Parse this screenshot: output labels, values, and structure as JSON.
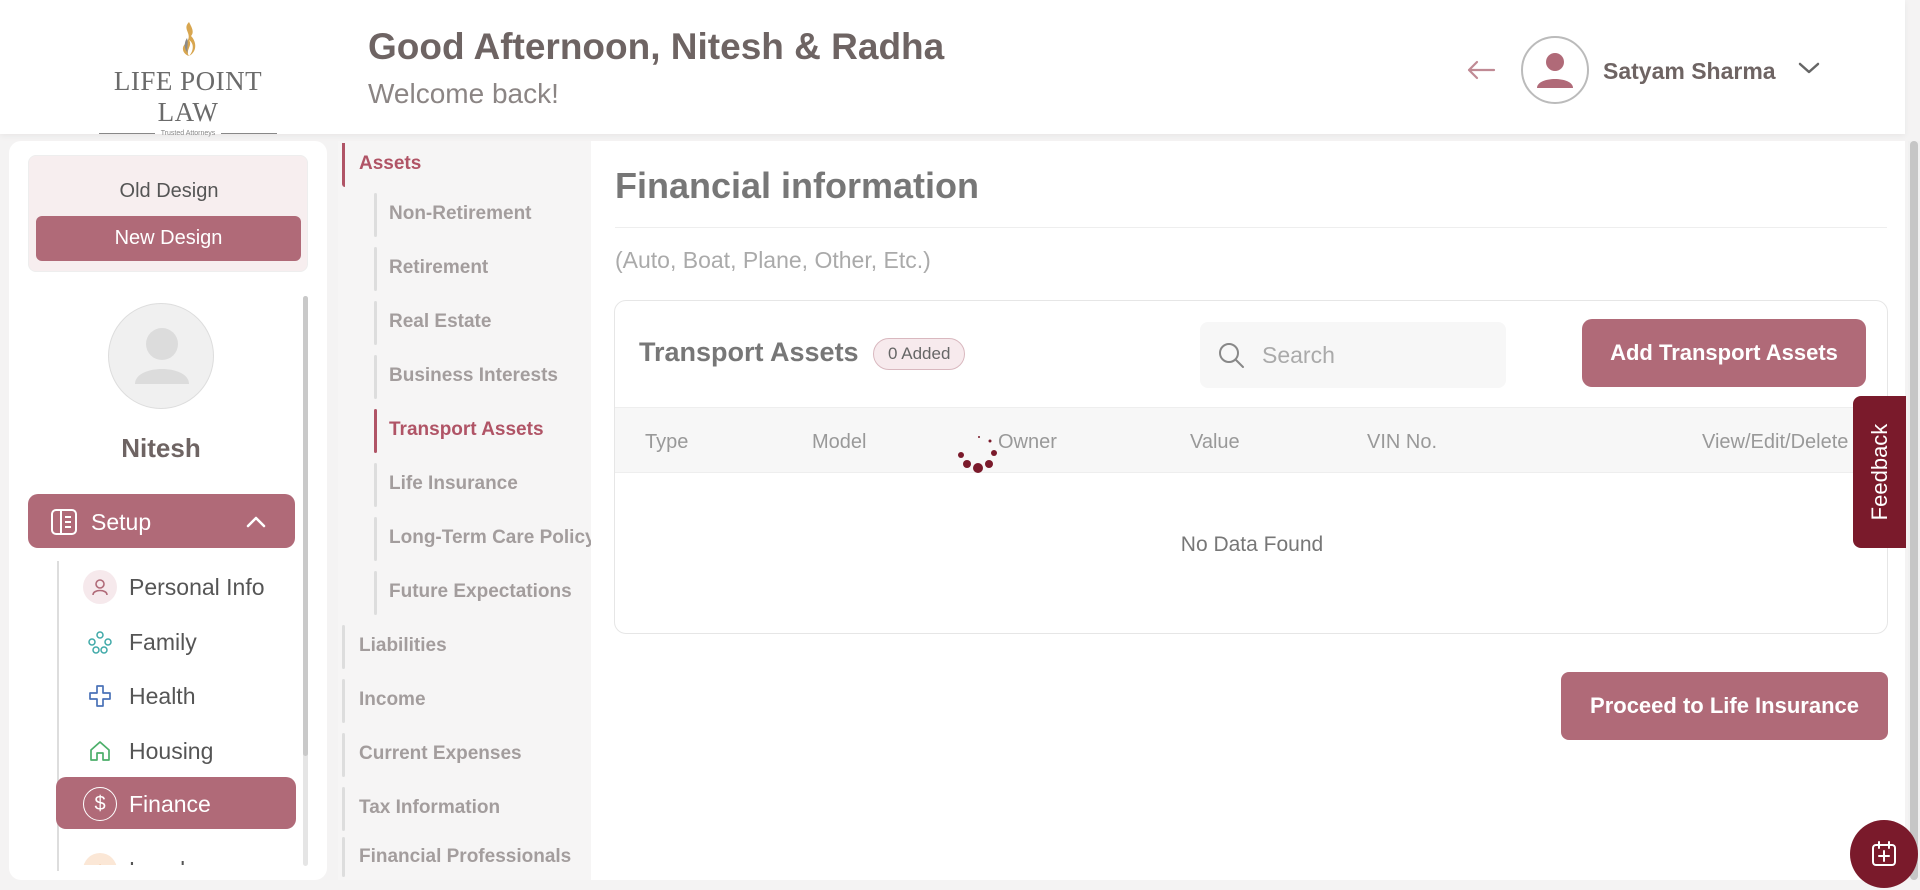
{
  "header": {
    "logo_text": "LIFE POINT LAW",
    "logo_tagline": "Trusted Attorneys",
    "greeting": "Good Afternoon, Nitesh & Radha",
    "welcome": "Welcome back!",
    "user_name": "Satyam Sharma"
  },
  "sidebar": {
    "old_design": "Old Design",
    "new_design": "New Design",
    "profile_name": "Nitesh",
    "setup_label": "Setup",
    "items": [
      {
        "label": "Personal Info",
        "icon": "person-icon"
      },
      {
        "label": "Family",
        "icon": "family-icon"
      },
      {
        "label": "Health",
        "icon": "health-cross-icon"
      },
      {
        "label": "Housing",
        "icon": "house-icon"
      },
      {
        "label": "Finance",
        "icon": "dollar-icon",
        "active": true
      },
      {
        "label": "Legal",
        "icon": "legal-icon"
      }
    ]
  },
  "subnav": {
    "assets": "Assets",
    "asset_items": [
      "Non-Retirement",
      "Retirement",
      "Real Estate",
      "Business Interests",
      "Transport Assets",
      "Life Insurance",
      "Long-Term Care Policy",
      "Future Expectations"
    ],
    "sections": [
      "Liabilities",
      "Income",
      "Current Expenses",
      "Tax Information",
      "Financial Professionals"
    ]
  },
  "main": {
    "title": "Financial information",
    "subtitle": "(Auto, Boat, Plane, Other, Etc.)",
    "card_title": "Transport Assets",
    "badge": "0 Added",
    "search_placeholder": "Search",
    "add_button": "Add Transport Assets",
    "columns": [
      "Type",
      "Model",
      "Owner",
      "Value",
      "VIN No.",
      "View/Edit/Delete"
    ],
    "empty_text": "No Data Found",
    "proceed_button": "Proceed to Life Insurance"
  },
  "feedback": "Feedback",
  "colors": {
    "accent": "#b06a78",
    "accent_dark": "#7a1a2b",
    "active_text": "#b05466"
  }
}
